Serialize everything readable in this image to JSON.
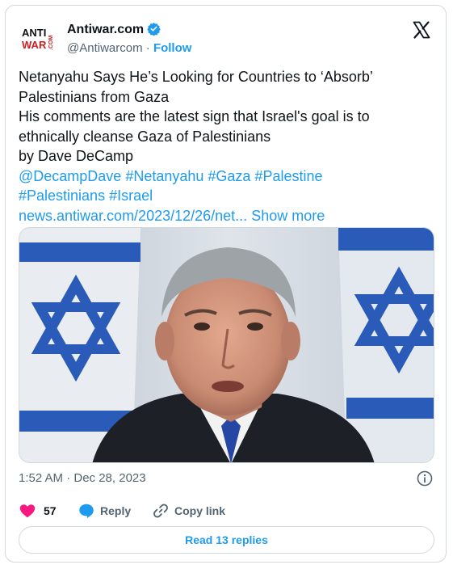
{
  "author": {
    "name": "Antiwar.com",
    "handle": "@Antiwarcom",
    "separator": "·",
    "follow_label": "Follow",
    "logo_text_top": "ANTI",
    "logo_text_bottom": "WAR",
    "logo_text_side": ".COM"
  },
  "tweet": {
    "lines": [
      "Netanyahu Says He’s Looking for Countries to ‘Absorb’",
      "Palestinians from Gaza",
      "His comments are the latest sign that Israel's goal is to",
      "ethnically cleanse Gaza of Palestinians",
      "by Dave DeCamp"
    ],
    "tags_line1": "@DecampDave #Netanyahu #Gaza #Palestine",
    "tags_line2": "#Palestinians #Israel",
    "link": "news.antiwar.com/2023/12/26/net...",
    "show_more": "Show more"
  },
  "meta": {
    "timestamp": "1:52 AM · Dec 28, 2023"
  },
  "actions": {
    "like_count": "57",
    "reply_label": "Reply",
    "copy_label": "Copy link",
    "read_replies_label": "Read 13 replies"
  },
  "colors": {
    "accent": "#1d9bf0",
    "like": "#f91880",
    "muted": "#536471",
    "border": "#cfd9de"
  },
  "icons": [
    "verified-badge-icon",
    "x-logo-icon",
    "info-icon",
    "heart-icon",
    "reply-bubble-icon",
    "copy-link-icon"
  ]
}
